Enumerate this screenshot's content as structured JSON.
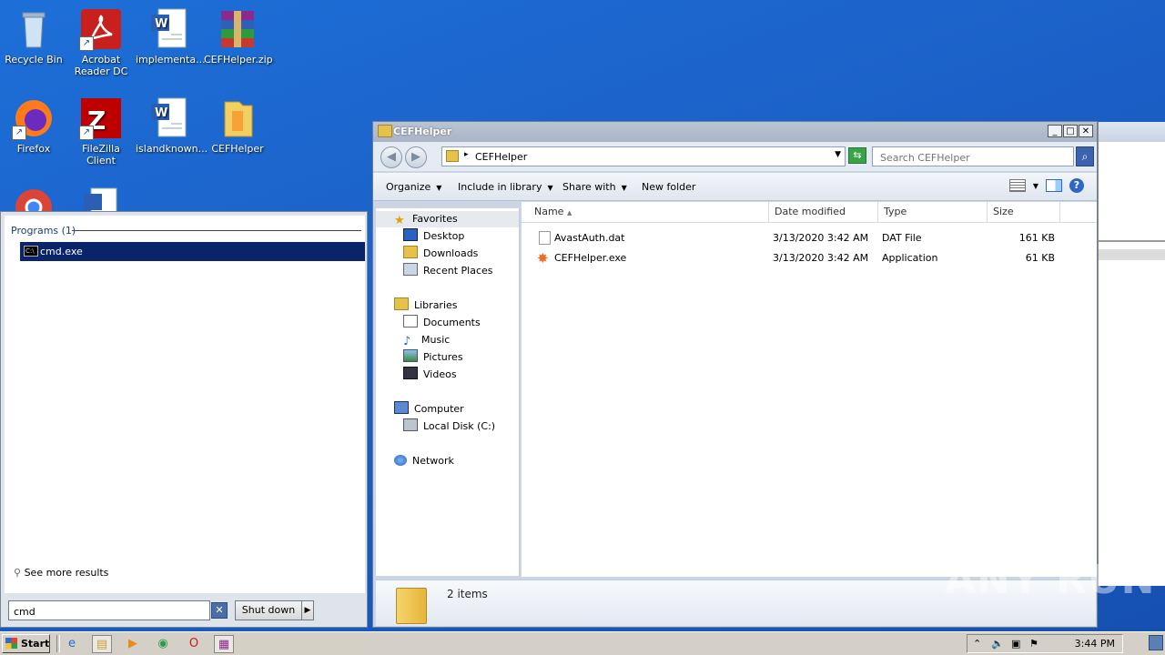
{
  "desktop": {
    "icons": [
      {
        "label": "Recycle Bin",
        "icon": "recycle-bin-icon"
      },
      {
        "label": "Acrobat Reader DC",
        "icon": "acrobat-icon"
      },
      {
        "label": "implementa...",
        "icon": "word-doc-icon"
      },
      {
        "label": "CEFHelper.zip",
        "icon": "winrar-icon"
      },
      {
        "label": "Firefox",
        "icon": "firefox-icon"
      },
      {
        "label": "FileZilla Client",
        "icon": "filezilla-icon"
      },
      {
        "label": "islandknown...",
        "icon": "word-doc-icon"
      },
      {
        "label": "CEFHelper",
        "icon": "folder-icon"
      }
    ]
  },
  "explorer": {
    "title": "CEFHelper",
    "window_buttons": {
      "minimize": "_",
      "maximize": "□",
      "close": "✕"
    },
    "address": {
      "path": "CEFHelper",
      "arrow": "▸"
    },
    "search": {
      "placeholder": "Search CEFHelper"
    },
    "toolbar": {
      "organize": "Organize",
      "include_in_library": "Include in library",
      "share_with": "Share with",
      "new_folder": "New folder"
    },
    "nav": {
      "favorites": "Favorites",
      "desktop": "Desktop",
      "downloads": "Downloads",
      "recent_places": "Recent Places",
      "libraries": "Libraries",
      "documents": "Documents",
      "music": "Music",
      "pictures": "Pictures",
      "videos": "Videos",
      "computer": "Computer",
      "local_disk": "Local Disk (C:)",
      "network": "Network"
    },
    "columns": {
      "name": "Name",
      "date_modified": "Date modified",
      "type": "Type",
      "size": "Size"
    },
    "files": [
      {
        "name": "AvastAuth.dat",
        "date": "3/13/2020 3:42 AM",
        "type": "DAT File",
        "size": "161 KB"
      },
      {
        "name": "CEFHelper.exe",
        "date": "3/13/2020 3:42 AM",
        "type": "Application",
        "size": "61 KB"
      }
    ],
    "status": {
      "items": "2 items"
    }
  },
  "start_menu": {
    "section": "Programs (1)",
    "result": "cmd.exe",
    "see_more": "See more results",
    "search_value": "cmd",
    "shutdown": "Shut down"
  },
  "taskbar": {
    "start": "Start",
    "clock": "3:44 PM"
  },
  "watermark": "ANY RUN",
  "colors": {
    "selection": "#0a246a",
    "desktop": "#1b5fc6"
  }
}
